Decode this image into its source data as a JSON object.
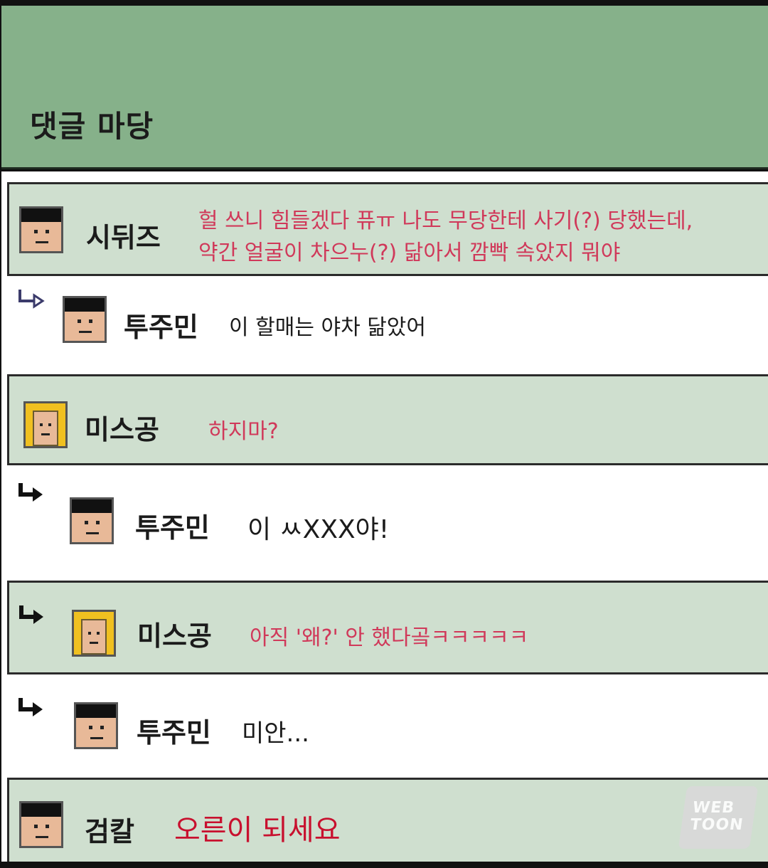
{
  "header": {
    "title": "댓글 마당"
  },
  "comments": [
    {
      "author": "시뒤즈",
      "text_line1": "헐 쓰니 힘들겠다 퓨ㅠ 나도 무당한테 사기(?) 당했는데,",
      "text_line2": "약간 얼굴이 차으누(?) 닮아서 깜빡 속았지 뭐야",
      "avatar": "male-avatar"
    },
    {
      "author": "투주민",
      "text": "이 할매는 야차 닮았어",
      "avatar": "male-avatar",
      "reply": true
    },
    {
      "author": "미스공",
      "text": "하지마?",
      "avatar": "female-avatar"
    },
    {
      "author": "투주민",
      "text": "이 ㅆXXX야!",
      "avatar": "male-avatar",
      "reply": true
    },
    {
      "author": "미스공",
      "text": "아직 '왜?' 안 했다곸ㅋㅋㅋㅋㅋ",
      "avatar": "female-avatar",
      "reply": true
    },
    {
      "author": "투주민",
      "text": "미안...",
      "avatar": "male-avatar",
      "reply": true
    },
    {
      "author": "검칼",
      "text": "오른이 되세요",
      "avatar": "male-avatar"
    }
  ],
  "watermark": {
    "line1": "WEB",
    "line2": "TOON"
  },
  "colors": {
    "header_bg": "#86b18a",
    "row_shaded": "#cfdfcf",
    "comment_red": "#d0395a"
  }
}
